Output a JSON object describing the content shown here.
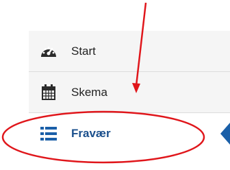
{
  "nav": {
    "items": [
      {
        "label": "Start",
        "icon": "dashboard-icon"
      },
      {
        "label": "Skema",
        "icon": "calendar-icon"
      },
      {
        "label": "Fravær",
        "icon": "list-icon",
        "active": true
      }
    ]
  },
  "colors": {
    "active_text": "#1a4f8c",
    "annotation": "#e0161b",
    "item_background": "#f5f5f5"
  }
}
